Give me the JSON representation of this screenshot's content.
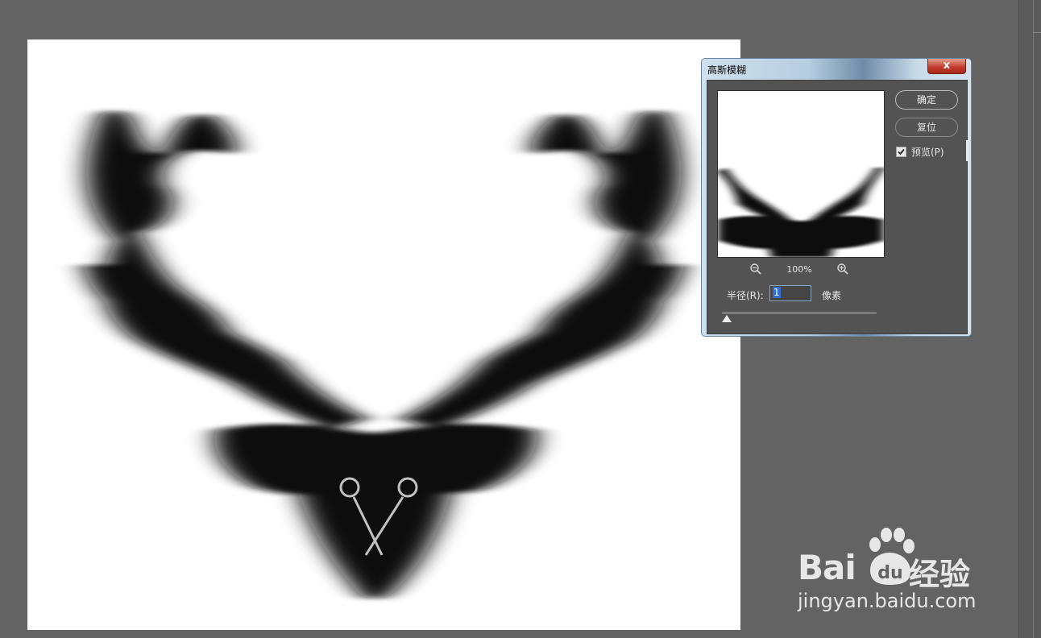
{
  "dialog": {
    "title": "高斯模糊",
    "close_glyph": "x",
    "ok_label": "确定",
    "reset_label": "复位",
    "preview_label": "预览(P)",
    "preview_checked": true,
    "zoom_level": "100%",
    "radius_label": "半径(R):",
    "radius_value": "1",
    "unit_label": "像素",
    "slider_value_fraction": 0.03
  },
  "icons": {
    "zoom_out": "zoom-out-icon",
    "zoom_in": "zoom-in-icon",
    "check": "check-icon",
    "close": "close-icon"
  },
  "watermark": {
    "brand_latin": "Bai",
    "brand_du": "du",
    "brand_cn": "经验",
    "url": "jingyan.baidu.com"
  },
  "colors": {
    "workspace": "#636363",
    "dialog_body": "#535353",
    "close_button": "#c0392b",
    "selection": "#2f6fcf"
  }
}
